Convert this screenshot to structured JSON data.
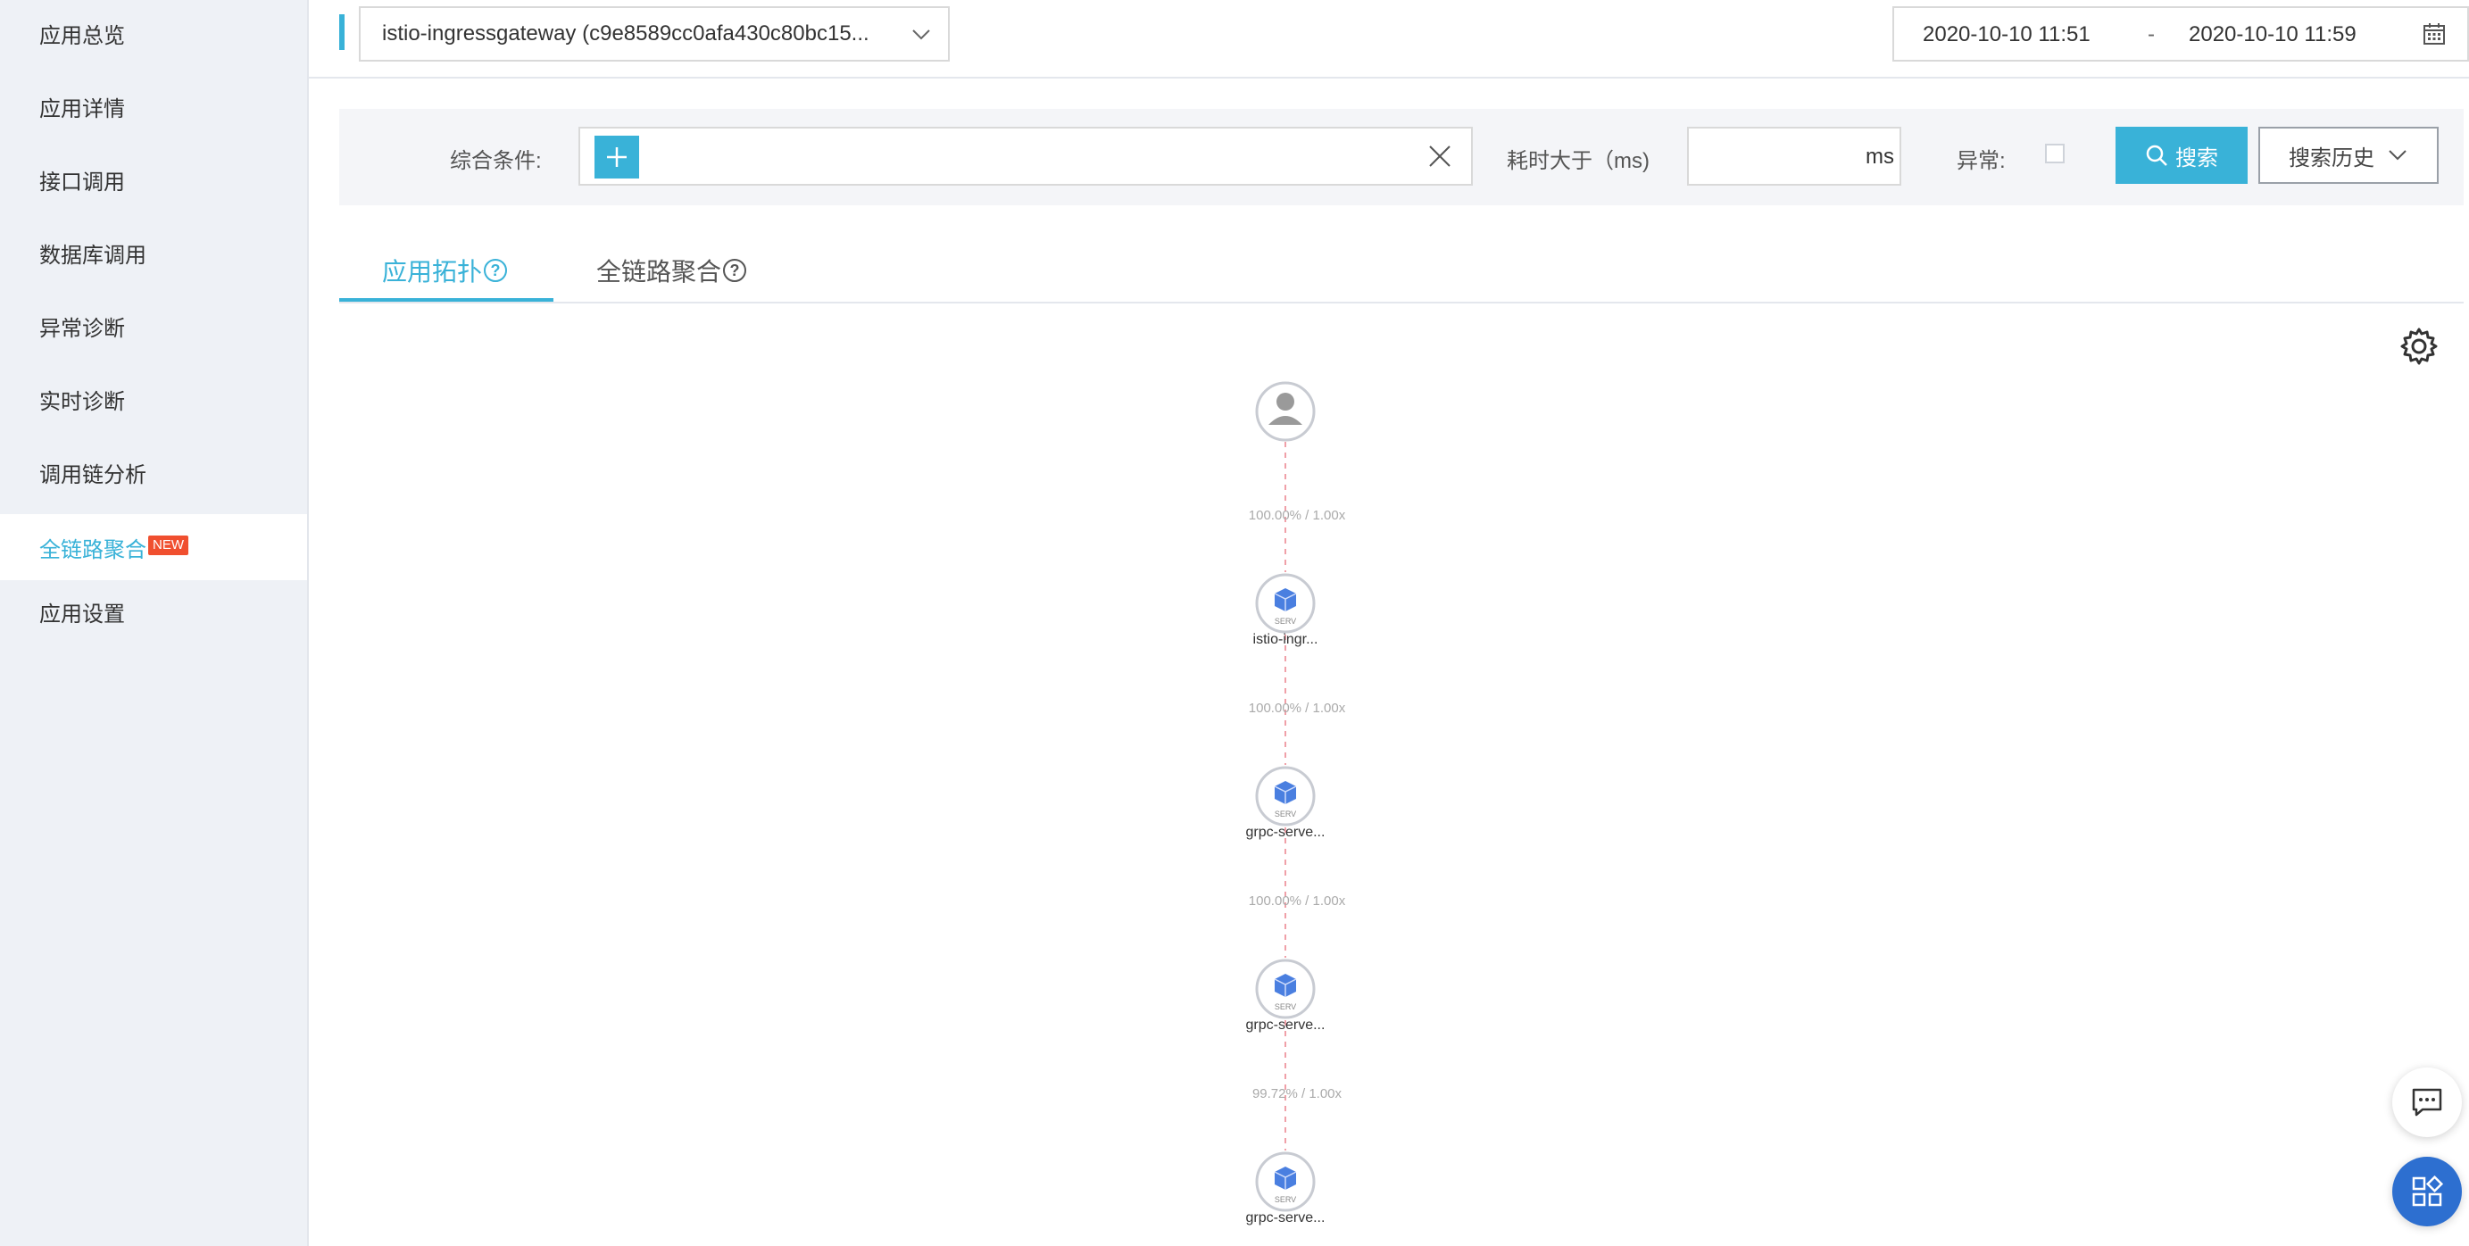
{
  "sidebar": {
    "items": [
      {
        "label": "应用总览"
      },
      {
        "label": "应用详情"
      },
      {
        "label": "接口调用"
      },
      {
        "label": "数据库调用"
      },
      {
        "label": "异常诊断"
      },
      {
        "label": "实时诊断"
      },
      {
        "label": "调用链分析"
      },
      {
        "label": "全链路聚合",
        "badge": "NEW",
        "active": true
      },
      {
        "label": "应用设置"
      }
    ]
  },
  "header": {
    "app_select_value": "istio-ingressgateway (c9e8589cc0afa430c80bc15...",
    "date_from": "2020-10-10 11:51",
    "date_sep": "-",
    "date_to": "2020-10-10 11:59"
  },
  "search": {
    "condition_label": "综合条件:",
    "duration_label": "耗时大于（ms)",
    "duration_unit": "ms",
    "exception_label": "异常:",
    "search_button": "搜索",
    "history_button": "搜索历史"
  },
  "tabs": [
    {
      "label": "应用拓扑",
      "active": true
    },
    {
      "label": "全链路聚合",
      "active": false
    }
  ],
  "topology": {
    "edges": [
      {
        "label": "100.00% / 1.00x"
      },
      {
        "label": "100.00% / 1.00x"
      },
      {
        "label": "100.00% / 1.00x"
      },
      {
        "label": "99.72% / 1.00x"
      }
    ],
    "nodes": [
      {
        "type": "user",
        "icon": "user-icon",
        "label": ""
      },
      {
        "type": "service",
        "icon": "cube-icon",
        "badge": "SERV",
        "label": "istio-ingr..."
      },
      {
        "type": "service",
        "icon": "cube-icon",
        "badge": "SERV",
        "label": "grpc-serve..."
      },
      {
        "type": "service",
        "icon": "cube-icon",
        "badge": "SERV",
        "label": "grpc-serve..."
      },
      {
        "type": "service",
        "icon": "cube-icon",
        "badge": "SERV",
        "label": "grpc-serve..."
      }
    ]
  },
  "colors": {
    "accent": "#39b2d8",
    "badge": "#f04f2f",
    "edge": "#f0a0a8",
    "node_icon": "#4a7fe0",
    "fab": "#2d6fd0"
  }
}
